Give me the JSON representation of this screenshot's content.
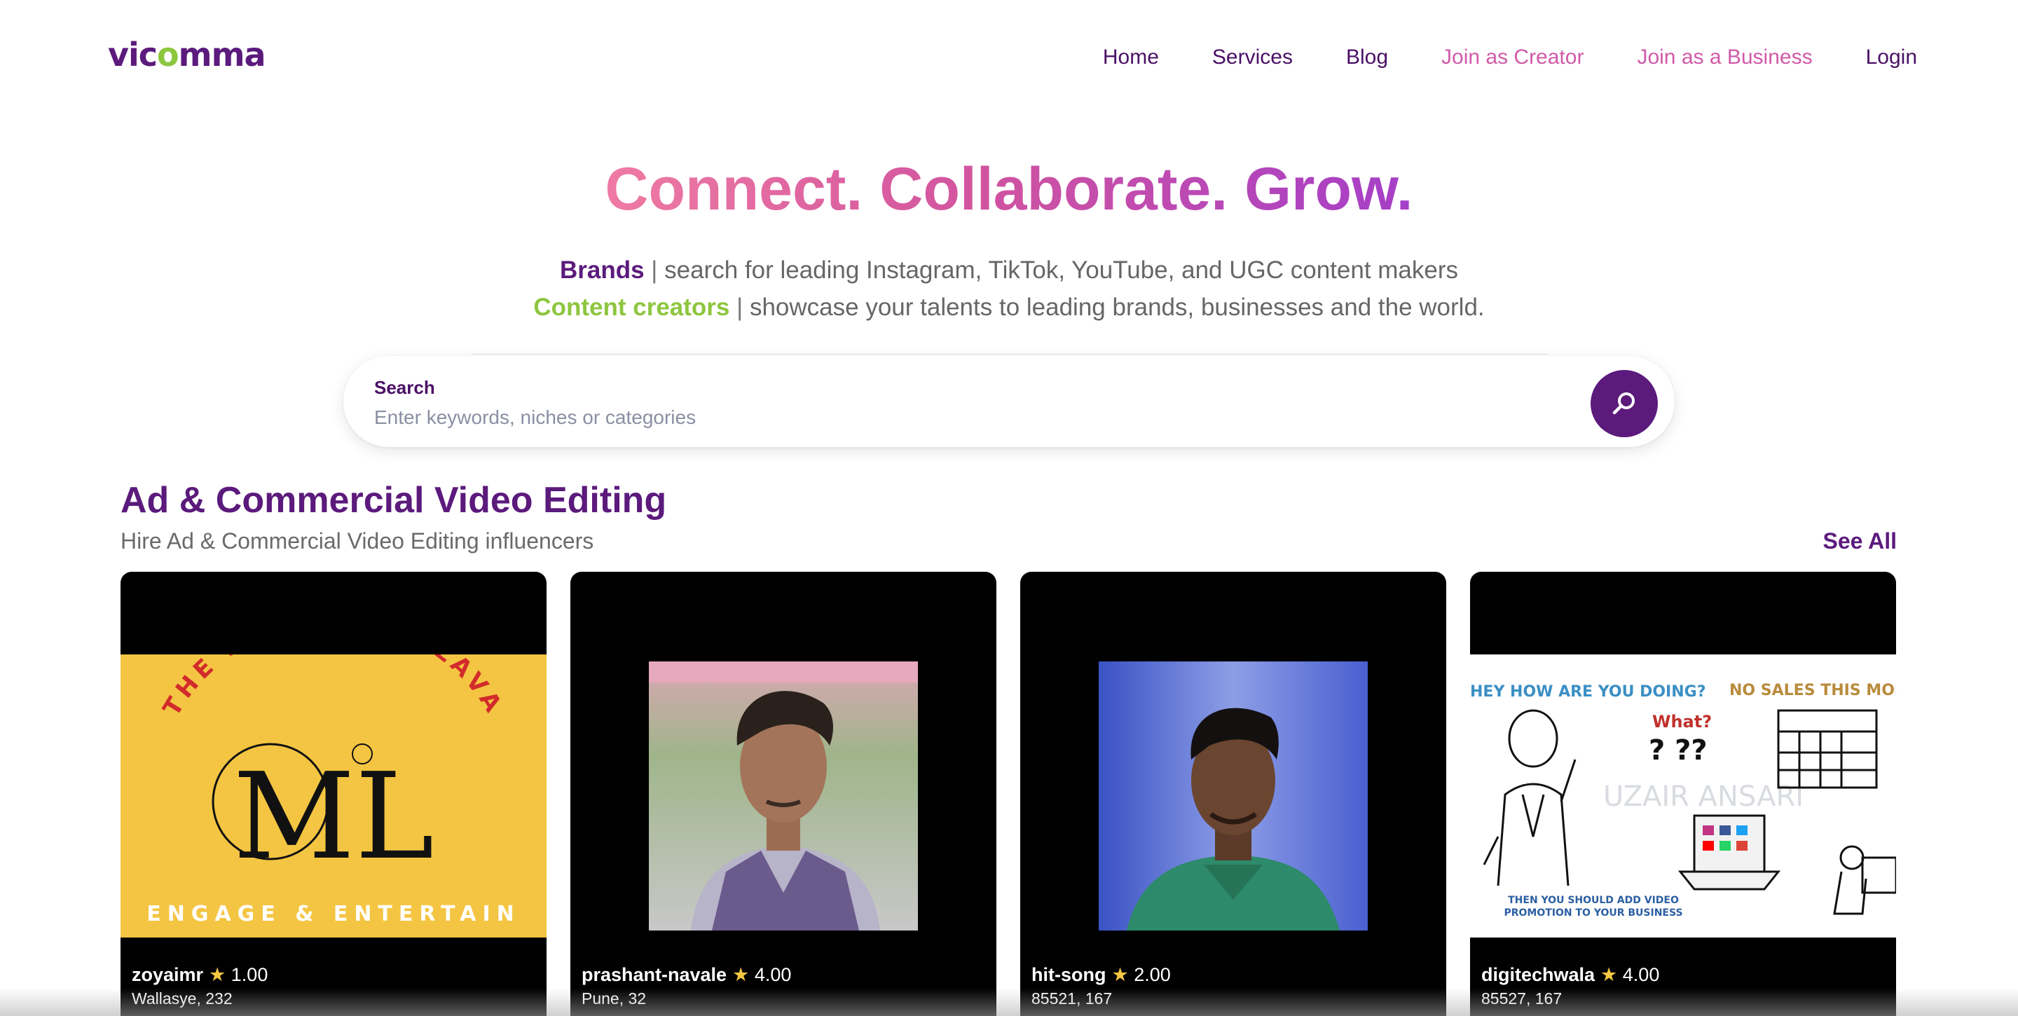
{
  "header": {
    "logo_text": [
      "vic",
      "o",
      "mma"
    ],
    "nav": [
      {
        "label": "Home",
        "style": "dark"
      },
      {
        "label": "Services",
        "style": "dark"
      },
      {
        "label": "Blog",
        "style": "dark"
      },
      {
        "label": "Join as Creator",
        "style": "pink"
      },
      {
        "label": "Join as a Business",
        "style": "pink"
      },
      {
        "label": "Login",
        "style": "dark"
      }
    ]
  },
  "hero": {
    "title": "Connect. Collaborate. Grow.",
    "line1": {
      "strong": "Brands",
      "sep": " | ",
      "text": "search for leading Instagram, TikTok, YouTube, and UGC content makers"
    },
    "line2": {
      "strong": "Content creators",
      "sep": " | ",
      "text": "showcase your talents to leading brands, businesses and the world."
    }
  },
  "search": {
    "label": "Search",
    "placeholder": "Enter keywords, niches or categories",
    "value": ""
  },
  "section": {
    "title": "Ad & Commercial Video Editing",
    "subtitle": "Hire Ad & Commercial Video Editing influencers",
    "see_all": "See All"
  },
  "cards": [
    {
      "name": "zoyaimr",
      "rating": "1.00",
      "location": "Wallasye, 232",
      "image": "marketing-lava-logo"
    },
    {
      "name": "prashant-navale",
      "rating": "4.00",
      "location": "Pune, 32",
      "image": "profile-photo"
    },
    {
      "name": "hit-song",
      "rating": "2.00",
      "location": "85521, 167",
      "image": "profile-photo"
    },
    {
      "name": "digitechwala",
      "rating": "4.00",
      "location": "85527, 167",
      "image": "video-promotion-illustration"
    }
  ],
  "card_art": {
    "ml_ring_top": "THE MARKETING LAVA",
    "ml_monogram": "ML",
    "ml_tagline": "ENGAGE & ENTERTAIN",
    "promo_hey": "HEY HOW ARE YOU DOING?",
    "promo_nosales": "NO SALES THIS MONT",
    "promo_what": "What?",
    "promo_watermark": "UZAIR ANSARI",
    "promo_bottom_1": "THEN YOU SHOULD ADD VIDEO",
    "promo_bottom_2": "PROMOTION TO YOUR BUSINESS"
  },
  "colors": {
    "brand_purple": "#5b1a7c",
    "brand_green": "#8dc63f",
    "pink": "#d05aa9"
  }
}
